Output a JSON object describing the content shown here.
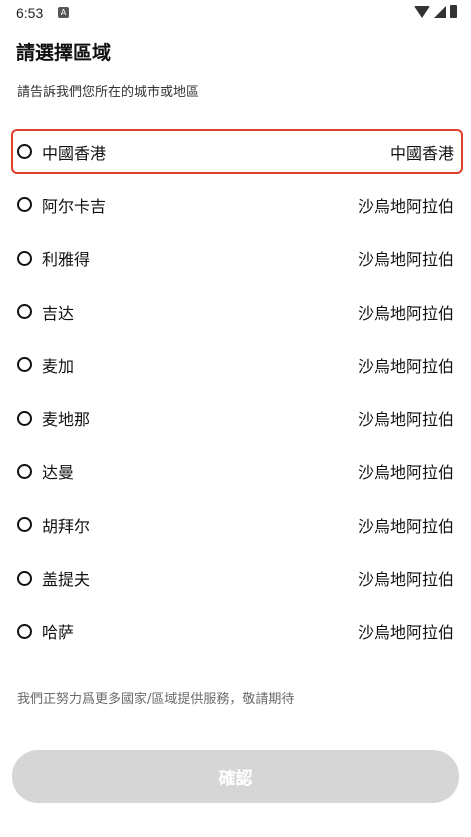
{
  "status_bar": {
    "time": "6:53",
    "a_icon": "A"
  },
  "header": {
    "title": "請選擇區域",
    "subtitle": "請告訴我們您所在的城市或地區"
  },
  "regions": [
    {
      "city": "中國香港",
      "country": "中國香港",
      "selected": true
    },
    {
      "city": "阿尔卡吉",
      "country": "沙烏地阿拉伯",
      "selected": false
    },
    {
      "city": "利雅得",
      "country": "沙烏地阿拉伯",
      "selected": false
    },
    {
      "city": "吉达",
      "country": "沙烏地阿拉伯",
      "selected": false
    },
    {
      "city": "麦加",
      "country": "沙烏地阿拉伯",
      "selected": false
    },
    {
      "city": "麦地那",
      "country": "沙烏地阿拉伯",
      "selected": false
    },
    {
      "city": "达曼",
      "country": "沙烏地阿拉伯",
      "selected": false
    },
    {
      "city": "胡拜尔",
      "country": "沙烏地阿拉伯",
      "selected": false
    },
    {
      "city": "盖提夫",
      "country": "沙烏地阿拉伯",
      "selected": false
    },
    {
      "city": "哈萨",
      "country": "沙烏地阿拉伯",
      "selected": false
    }
  ],
  "footer": {
    "note": "我們正努力爲更多國家/區域提供服務，敬請期待",
    "confirm_label": "確認"
  },
  "colors": {
    "selected_border": "#e0402a",
    "button_disabled": "#d6d6d6"
  }
}
